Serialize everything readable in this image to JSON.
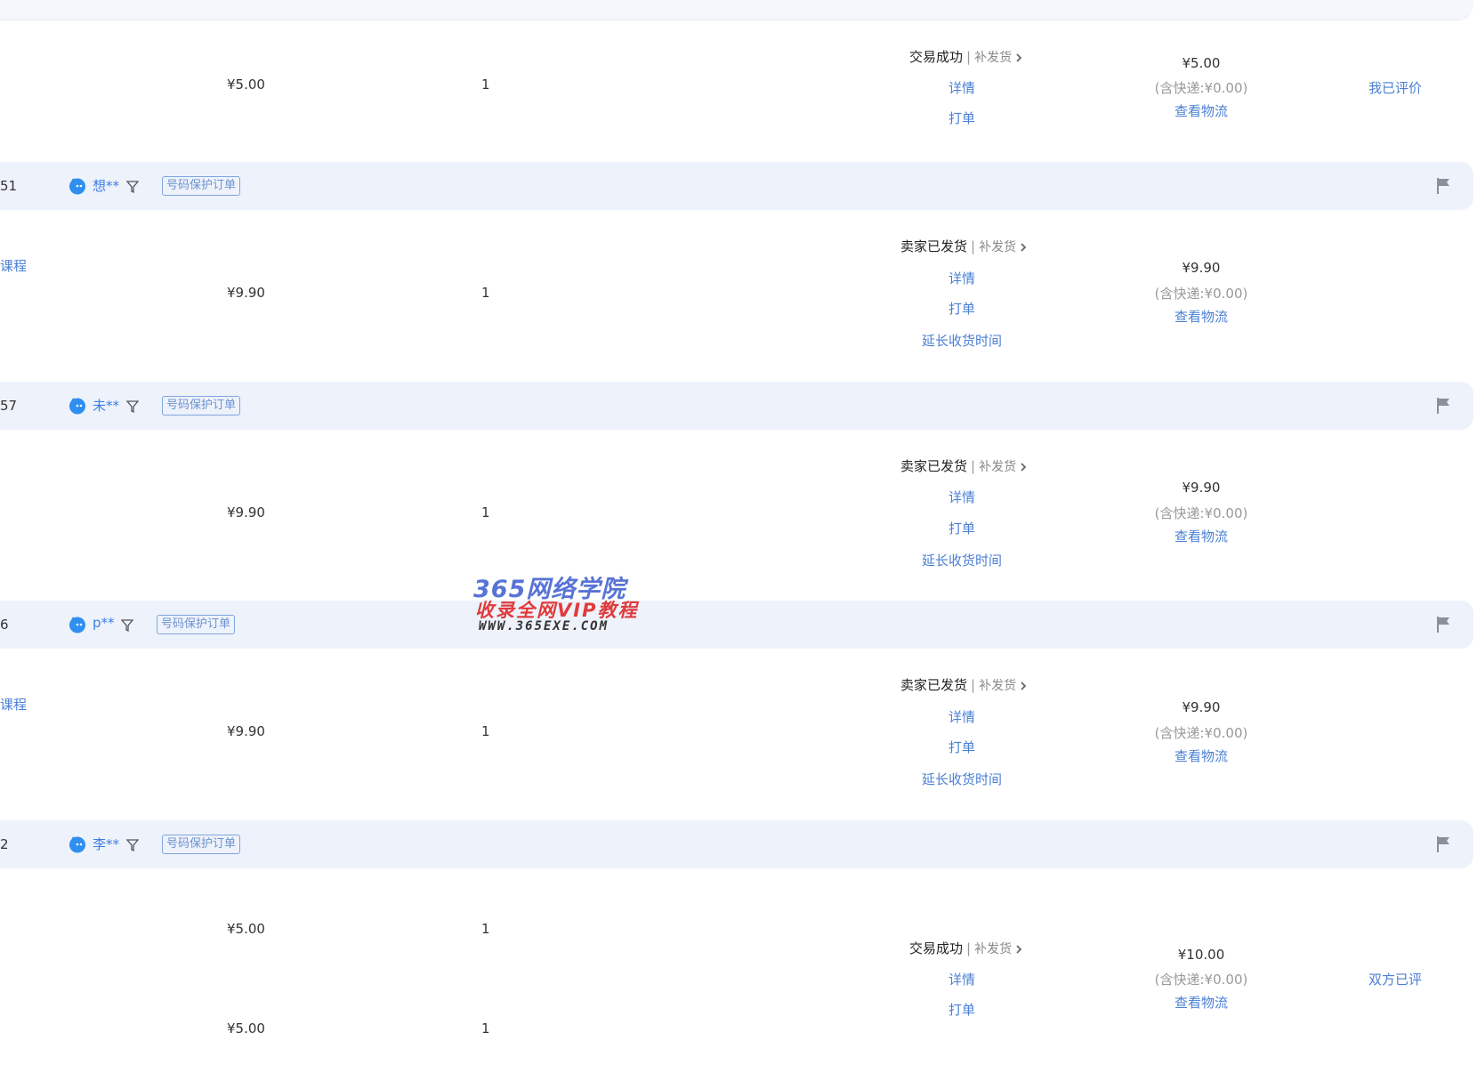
{
  "colors": {
    "link": "#4a7fd4",
    "header_bg": "#eef2fb",
    "tag_border": "#7fa6dd",
    "flag": "#8a8f99"
  },
  "icons": {
    "avatar": "wangwang-avatar-icon",
    "filter": "filter-icon",
    "flag": "flag-icon",
    "chevron": "chevron-right-icon"
  },
  "labels": {
    "tag": "号码保护订单",
    "resend": "补发货",
    "detail": "详情",
    "print": "打单",
    "extend": "延长收货时间",
    "logistics": "查看物流",
    "currency": "¥"
  },
  "order0": {
    "price": "¥5.00",
    "qty": "1",
    "status": "交易成功",
    "total": "¥5.00",
    "shipping": "(含快递:¥0.00)",
    "review": "我已评价"
  },
  "order1": {
    "id_tail": "51",
    "buyer": "想**",
    "left_text": "课程",
    "price": "¥9.90",
    "qty": "1",
    "status": "卖家已发货",
    "total": "¥9.90",
    "shipping": "(含快递:¥0.00)"
  },
  "order2": {
    "id_tail": "57",
    "buyer": "未**",
    "price": "¥9.90",
    "qty": "1",
    "status": "卖家已发货",
    "total": "¥9.90",
    "shipping": "(含快递:¥0.00)"
  },
  "order3": {
    "id_tail": "6",
    "buyer": "p**",
    "left_text": "课程",
    "price": "¥9.90",
    "qty": "1",
    "status": "卖家已发货",
    "total": "¥9.90",
    "shipping": "(含快递:¥0.00)"
  },
  "order4": {
    "id_tail": "2",
    "buyer": "李**",
    "items": [
      {
        "price": "¥5.00",
        "qty": "1"
      },
      {
        "price": "¥5.00",
        "qty": "1"
      }
    ],
    "status": "交易成功",
    "total": "¥10.00",
    "shipping": "(含快递:¥0.00)",
    "review": "双方已评"
  },
  "watermark": {
    "line1": "365网络学院",
    "line2": "收录全网VIP教程",
    "line3": "WWW.365EXE.COM"
  }
}
